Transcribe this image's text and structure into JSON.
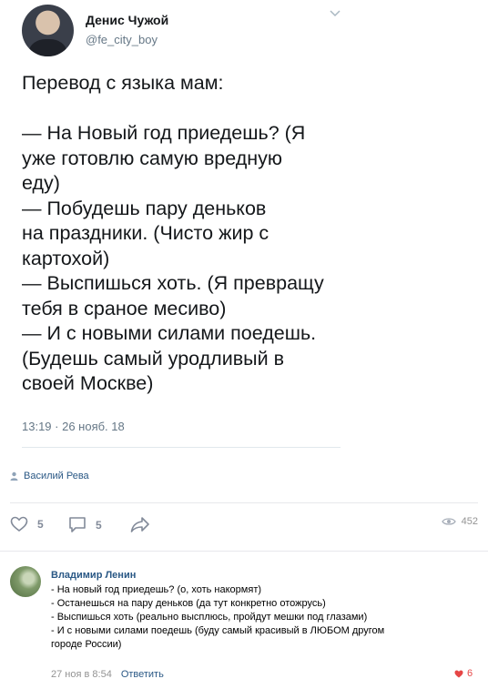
{
  "tweet": {
    "author_name": "Денис Чужой",
    "author_handle": "@fe_city_boy",
    "lines": [
      "Перевод с языка мам:",
      "",
      "— На Новый год приедешь? (Я",
      "уже готовлю самую вредную",
      "еду)",
      "— Побудешь пару деньков",
      "на праздники. (Чисто жир с",
      "картохой)",
      "— Выспишься хоть. (Я превращу",
      "тебя в сраное месиво)",
      "— И с новыми силами поедешь.",
      "(Будешь самый уродливый в",
      "своей Москве)"
    ],
    "timestamp": "13:19 · 26 нояб. 18"
  },
  "post": {
    "attribution": "Василий Рева",
    "likes": "5",
    "comments": "5",
    "views": "452"
  },
  "comment": {
    "author": "Владимир Ленин",
    "lines": [
      "- На новый год приедешь? (о, хоть накормят)",
      "- Останешься на пару деньков (да тут конкретно отожрусь)",
      "- Выспишься хоть (реально высплюсь, пройдут мешки под глазами)",
      "- И с новыми силами поедешь (буду самый красивый в ЛЮБОМ другом",
      "городе России)"
    ],
    "date": "27 ноя в 8:54",
    "reply_label": "Ответить",
    "likes": "6"
  },
  "colors": {
    "link": "#2a5885",
    "muted": "#828a99",
    "like_red": "#e64646"
  },
  "icons": [
    "caret-down-icon",
    "person-icon",
    "heart-icon",
    "comment-icon",
    "share-icon",
    "eye-icon"
  ]
}
